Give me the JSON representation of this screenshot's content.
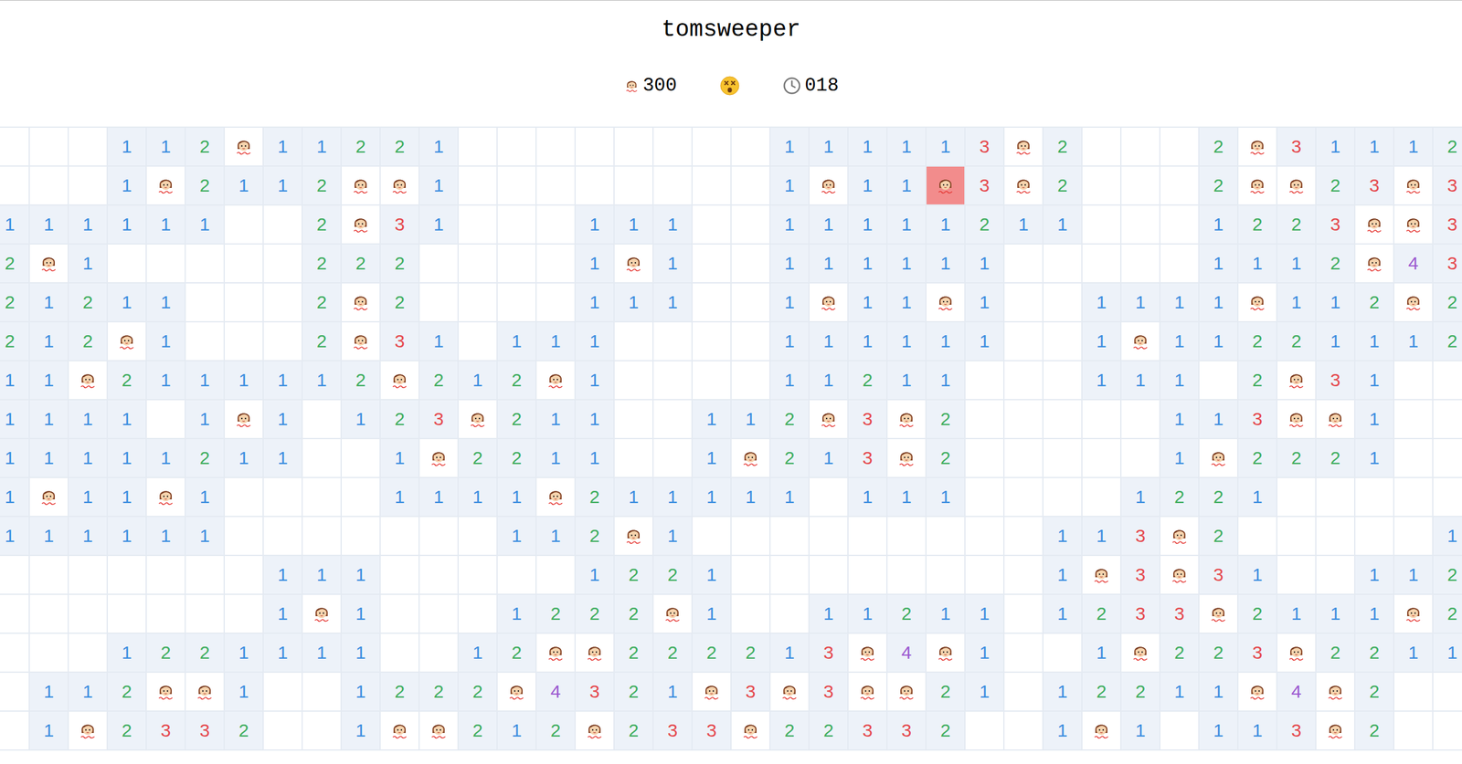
{
  "title": "tomsweeper",
  "status": {
    "mines_left": "300",
    "face": "dead",
    "time": "018"
  },
  "number_colors": {
    "1": "#3b8ee0",
    "2": "#3fae5f",
    "3": "#e5484d",
    "4": "#9b59d0"
  },
  "board": {
    "rows": [
      [
        "",
        "",
        "",
        "1",
        "1",
        "2",
        "mine",
        "1",
        "1",
        "2",
        "2",
        "1",
        "",
        "",
        "",
        "",
        "",
        "",
        "",
        "",
        "1",
        "1",
        "1",
        "1",
        "1",
        "3",
        "mine",
        "2",
        "",
        "",
        "",
        "2",
        "mine",
        "3",
        "1",
        "1",
        "1",
        "2"
      ],
      [
        "",
        "",
        "",
        "1",
        "mine",
        "2",
        "1",
        "1",
        "2",
        "mine",
        "mine",
        "1",
        "",
        "",
        "",
        "",
        "",
        "",
        "",
        "",
        "1",
        "mine",
        "1",
        "1",
        "exploded",
        "3",
        "mine",
        "2",
        "",
        "",
        "",
        "2",
        "mine",
        "mine",
        "2",
        "3",
        "mine",
        "3"
      ],
      [
        "1",
        "1",
        "1",
        "1",
        "1",
        "1",
        "",
        "",
        "2",
        "mine",
        "3",
        "1",
        "",
        "",
        "",
        "1",
        "1",
        "1",
        "",
        "",
        "1",
        "1",
        "1",
        "1",
        "1",
        "2",
        "1",
        "1",
        "",
        "",
        "",
        "1",
        "2",
        "2",
        "3",
        "mine",
        "mine",
        "3"
      ],
      [
        "2",
        "mine",
        "1",
        "",
        "",
        "",
        "",
        "",
        "2",
        "2",
        "2",
        "",
        "",
        "",
        "",
        "1",
        "mine",
        "1",
        "",
        "",
        "1",
        "1",
        "1",
        "1",
        "1",
        "1",
        "",
        "",
        "",
        "",
        "",
        "1",
        "1",
        "1",
        "2",
        "mine",
        "4",
        "3"
      ],
      [
        "2",
        "1",
        "2",
        "1",
        "1",
        "",
        "",
        "",
        "2",
        "mine",
        "2",
        "",
        "",
        "",
        "",
        "1",
        "1",
        "1",
        "",
        "",
        "1",
        "mine",
        "1",
        "1",
        "mine",
        "1",
        "",
        "",
        "1",
        "1",
        "1",
        "1",
        "mine",
        "1",
        "1",
        "2",
        "mine",
        "2"
      ],
      [
        "2",
        "1",
        "2",
        "mine",
        "1",
        "",
        "",
        "",
        "2",
        "mine",
        "3",
        "1",
        "",
        "1",
        "1",
        "1",
        "",
        "",
        "",
        "",
        "1",
        "1",
        "1",
        "1",
        "1",
        "1",
        "",
        "",
        "1",
        "mine",
        "1",
        "1",
        "2",
        "2",
        "1",
        "1",
        "1",
        "2"
      ],
      [
        "1",
        "1",
        "mine",
        "2",
        "1",
        "1",
        "1",
        "1",
        "1",
        "2",
        "mine",
        "2",
        "1",
        "2",
        "mine",
        "1",
        "",
        "",
        "",
        "",
        "1",
        "1",
        "2",
        "1",
        "1",
        "",
        "",
        "",
        "1",
        "1",
        "1",
        "",
        "2",
        "mine",
        "3",
        "1",
        "",
        ""
      ],
      [
        "1",
        "1",
        "1",
        "1",
        "",
        "1",
        "mine",
        "1",
        "",
        "1",
        "2",
        "3",
        "mine",
        "2",
        "1",
        "1",
        "",
        "",
        "1",
        "1",
        "2",
        "mine",
        "3",
        "mine",
        "2",
        "",
        "",
        "",
        "",
        "",
        "1",
        "1",
        "3",
        "mine",
        "mine",
        "1",
        "",
        ""
      ],
      [
        "1",
        "1",
        "1",
        "1",
        "1",
        "2",
        "1",
        "1",
        "",
        "",
        "1",
        "mine",
        "2",
        "2",
        "1",
        "1",
        "",
        "",
        "1",
        "mine",
        "2",
        "1",
        "3",
        "mine",
        "2",
        "",
        "",
        "",
        "",
        "",
        "1",
        "mine",
        "2",
        "2",
        "2",
        "1",
        "",
        ""
      ],
      [
        "1",
        "mine",
        "1",
        "1",
        "mine",
        "1",
        "",
        "",
        "",
        "",
        "1",
        "1",
        "1",
        "1",
        "mine",
        "2",
        "1",
        "1",
        "1",
        "1",
        "1",
        "",
        "1",
        "1",
        "1",
        "",
        "",
        "",
        "",
        "1",
        "2",
        "2",
        "1",
        "",
        "",
        "",
        "",
        ""
      ],
      [
        "1",
        "1",
        "1",
        "1",
        "1",
        "1",
        "",
        "",
        "",
        "",
        "",
        "",
        "",
        "1",
        "1",
        "2",
        "mine",
        "1",
        "",
        "",
        "",
        "",
        "",
        "",
        "",
        "",
        "",
        "1",
        "1",
        "3",
        "mine",
        "2",
        "",
        "",
        "",
        "",
        "",
        "1"
      ],
      [
        "",
        "",
        "",
        "",
        "",
        "",
        "",
        "1",
        "1",
        "1",
        "",
        "",
        "",
        "",
        "",
        "1",
        "2",
        "2",
        "1",
        "",
        "",
        "",
        "",
        "",
        "",
        "",
        "",
        "1",
        "mine",
        "3",
        "mine",
        "3",
        "1",
        "",
        "",
        "1",
        "1",
        "2"
      ],
      [
        "",
        "",
        "",
        "",
        "",
        "",
        "",
        "1",
        "mine",
        "1",
        "",
        "",
        "",
        "1",
        "2",
        "2",
        "2",
        "mine",
        "1",
        "",
        "",
        "1",
        "1",
        "2",
        "1",
        "1",
        "",
        "1",
        "2",
        "3",
        "3",
        "mine",
        "2",
        "1",
        "1",
        "1",
        "mine",
        "2"
      ],
      [
        "",
        "",
        "",
        "1",
        "2",
        "2",
        "1",
        "1",
        "1",
        "1",
        "",
        "",
        "1",
        "2",
        "mine",
        "mine",
        "2",
        "2",
        "2",
        "2",
        "1",
        "3",
        "mine",
        "4",
        "mine",
        "1",
        "",
        "",
        "1",
        "mine",
        "2",
        "2",
        "3",
        "mine",
        "2",
        "2",
        "1",
        "1"
      ],
      [
        "",
        "1",
        "1",
        "2",
        "mine",
        "mine",
        "1",
        "",
        "",
        "1",
        "2",
        "2",
        "2",
        "mine",
        "4",
        "3",
        "2",
        "1",
        "mine",
        "3",
        "mine",
        "3",
        "mine",
        "mine",
        "2",
        "1",
        "",
        "1",
        "2",
        "2",
        "1",
        "1",
        "mine",
        "4",
        "mine",
        "2",
        "",
        ""
      ],
      [
        "",
        "1",
        "mine",
        "2",
        "3",
        "3",
        "2",
        "",
        "",
        "1",
        "mine",
        "mine",
        "2",
        "1",
        "2",
        "mine",
        "2",
        "3",
        "3",
        "mine",
        "2",
        "2",
        "3",
        "3",
        "2",
        "",
        "",
        "1",
        "mine",
        "1",
        "",
        "1",
        "1",
        "3",
        "mine",
        "2",
        "",
        ""
      ]
    ]
  }
}
